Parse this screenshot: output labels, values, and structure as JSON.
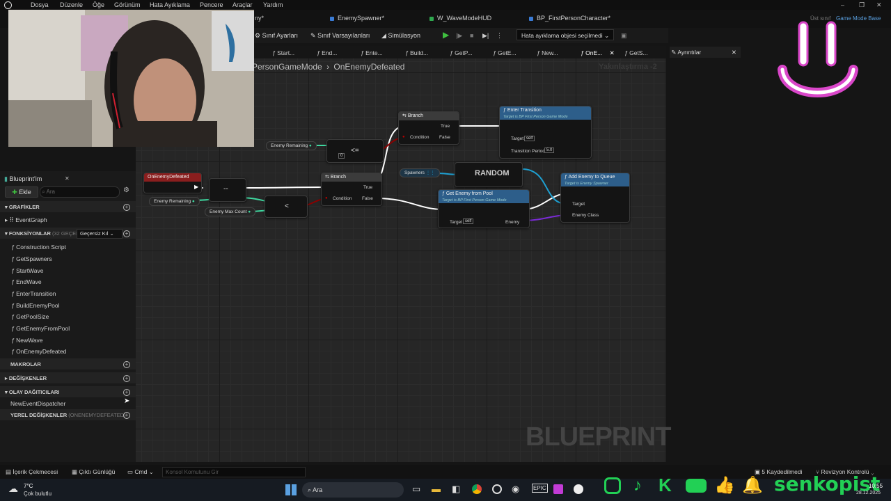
{
  "menu": [
    "Dosya",
    "Düzenle",
    "Öğe",
    "Görünüm",
    "Hata Ayıklama",
    "Pencere",
    "Araçlar",
    "Yardım"
  ],
  "asset_tabs": [
    {
      "label": "ny*",
      "color": "#8a8a8a"
    },
    {
      "label": "EnemySpawner*",
      "color": "#3a7bd5"
    },
    {
      "label": "W_WaveModeHUD",
      "color": "#2fa84f"
    },
    {
      "label": "BP_FirstPersonCharacter*",
      "color": "#3a7bd5"
    }
  ],
  "parent_class": {
    "label": "Üst sınıf",
    "value": "Game Mode Base"
  },
  "toolbar": {
    "class_settings": "Sınıf Ayarları",
    "class_defaults": "Sınıf Varsayılanları",
    "simulation": "Simülasyon",
    "debug_object": "Hata ayıklama objesi seçilmedi"
  },
  "graph_tabs": [
    "Start...",
    "End...",
    "Ente...",
    "Build...",
    "GetP...",
    "GetE...",
    "New...",
    "OnE...",
    "GetS..."
  ],
  "details_tab": "Ayrıntılar",
  "breadcrumb": {
    "parent": "PersonGameMode",
    "separator": "›",
    "current": "OnEnemyDefeated"
  },
  "zoom": "Yakınlaştırma -2",
  "watermark": "BLUEPRINT",
  "nodes": {
    "on_enemy_defeated": "OnEnemyDefeated",
    "enemy_remaining_1": "Enemy Remaining",
    "enemy_remaining_2": "Enemy Remaining",
    "enemy_max_count": "Enemy Max Count",
    "op_minus": "--",
    "op_lte": "<=",
    "op_lt": "<",
    "zero_value": "0",
    "branch1": {
      "title": "Branch",
      "condition": "Condition",
      "true": "True",
      "false": "False"
    },
    "branch2": {
      "title": "Branch",
      "condition": "Condition",
      "true": "True",
      "false": "False"
    },
    "enter_transition": {
      "title": "Enter Transition",
      "subtitle": "Target is BP First Person Game Mode",
      "target": "Target",
      "self": "self",
      "period_label": "Transition Period",
      "period_value": "5.0"
    },
    "spawners": "Spawners",
    "random": "RANDOM",
    "get_enemy_from_pool": {
      "title": "Get Enemy from Pool",
      "subtitle": "Target is BP First Person Game Mode",
      "target": "Target",
      "self": "self",
      "enemy": "Enemy"
    },
    "add_enemy_to_queue": {
      "title": "Add Enemy to Queue",
      "subtitle": "Target is Enemy Spawner",
      "target": "Target",
      "enemy_class": "Enemy Class"
    }
  },
  "left_panel": {
    "tab": "Blueprint'im",
    "add": "Ekle",
    "search_placeholder": "Ara",
    "graphs_header": "GRAFİKLER",
    "event_graph": "EventGraph",
    "functions_header": "FONKSİYONLAR",
    "functions_count": "(32 GEÇERS",
    "override_label": "Geçersiz Kıl",
    "functions": [
      "Construction Script",
      "GetSpawners",
      "StartWave",
      "EndWave",
      "EnterTransition",
      "BuildEnemyPool",
      "GetPoolSize",
      "GetEnemyFromPool",
      "NewWave",
      "OnEnemyDefeated"
    ],
    "macros_header": "MAKROLAR",
    "variables_header": "DEĞİŞKENLER",
    "dispatchers_header": "OLAY DAĞITICILARI",
    "dispatcher_item": "NewEventDispatcher",
    "local_vars_header": "YEREL DEĞİŞKENLER",
    "local_vars_scope": "(ONENEMYDEFEATED)"
  },
  "bottom_bar": {
    "content_drawer": "İçerik Çekmecesi",
    "output_log": "Çıktı Günlüğü",
    "cmd": "Cmd",
    "console_placeholder": "Konsol Komutunu Gir",
    "unsaved": "5 Kaydedilmedi",
    "revision": "Revizyon Kontrolü"
  },
  "taskbar": {
    "temp": "7°C",
    "weather": "Çok bulutlu",
    "search": "Ara",
    "brand": "senkopist",
    "time": "10:55",
    "date": "28.12.2025"
  },
  "colors": {
    "exec": "#ffffff",
    "bool": "#8b0000",
    "int": "#3fd8a0",
    "object": "#1e9fd0",
    "class": "#7a2bd6",
    "function_head": "#2d5e8a",
    "event_head": "#8a1e1e",
    "overlay": "#d946c9"
  }
}
